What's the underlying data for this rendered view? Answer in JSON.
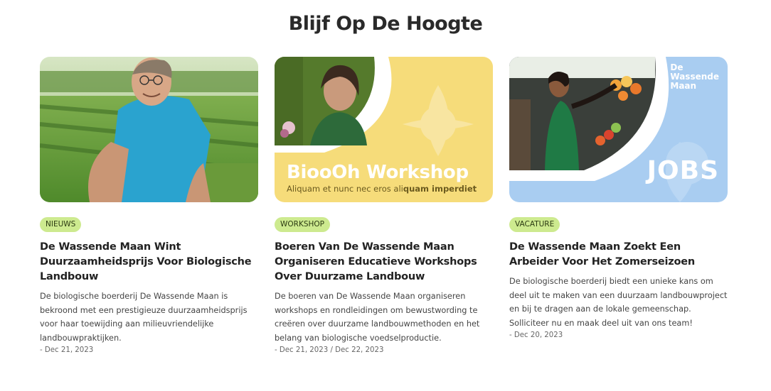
{
  "section": {
    "title": "Blijf Op De Hoogte"
  },
  "cards": [
    {
      "image_alt": "Boer in blauw T-shirt in een groenteveld",
      "badge": "NIEUWS",
      "title": "De Wassende Maan Wint Duurzaamheidsprijs Voor Biologische Landbouw",
      "description": "De biologische boerderij De Wassende Maan is bekroond met een prestigieuze duurzaamheidsprijs voor haar toewijding aan milieuvriendelijke landbouwpraktijken.",
      "date": "- Dec 21, 2023"
    },
    {
      "image_title": "BiooOh Workshop",
      "image_subtitle_plain": "Aliquam et nunc nec eros ali",
      "image_subtitle_bold": "quam imperdiet",
      "badge": "WORKSHOP",
      "title": "Boeren Van De Wassende Maan Organiseren Educatieve Workshops Over Duurzame Landbouw",
      "description": "De boeren van De Wassende Maan organiseren workshops en rondleidingen om bewustwording te creëren over duurzame landbouwmethoden en het belang van biologische voedselproductie.",
      "date": "- Dec 21, 2023 / Dec 22, 2023"
    },
    {
      "image_brand_line1": "De",
      "image_brand_line2": "Wassende",
      "image_brand_line3": "Maan",
      "image_word": "JOBS",
      "badge": "VACATURE",
      "title": "De Wassende Maan Zoekt Een Arbeider Voor Het Zomerseizoen",
      "description": "De biologische boerderij biedt een unieke kans om deel uit te maken van een duurzaam landbouwproject en bij te dragen aan de lokale gemeenschap. Solliciteer nu en maak deel uit van ons team!",
      "date": "- Dec 20, 2023"
    }
  ],
  "colors": {
    "badge_bg": "#cdea8f",
    "workshop_bg": "#f6dc7a",
    "jobs_bg": "#a9cdf1"
  }
}
